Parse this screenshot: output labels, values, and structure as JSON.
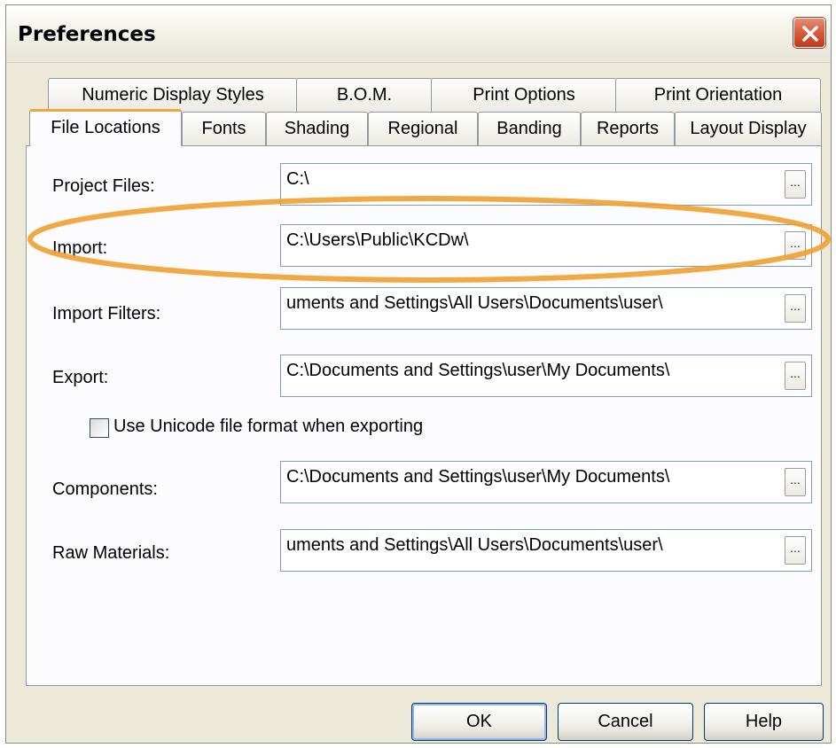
{
  "window": {
    "title": "Preferences",
    "close_icon": "close-icon"
  },
  "tabs": {
    "row1": [
      {
        "label": "Numeric Display Styles"
      },
      {
        "label": "B.O.M."
      },
      {
        "label": "Print Options"
      },
      {
        "label": "Print Orientation"
      }
    ],
    "row2": [
      {
        "label": "File Locations",
        "active": true
      },
      {
        "label": "Fonts"
      },
      {
        "label": "Shading"
      },
      {
        "label": "Regional"
      },
      {
        "label": "Banding"
      },
      {
        "label": "Reports"
      },
      {
        "label": "Layout Display"
      }
    ]
  },
  "fields": [
    {
      "label": "Project Files:",
      "value": "C:\\",
      "browse_label": "..."
    },
    {
      "label": "Import:",
      "value": "C:\\Users\\Public\\KCDw\\",
      "browse_label": "..."
    },
    {
      "label": "Import Filters:",
      "value": "uments and Settings\\All Users\\Documents\\user\\",
      "browse_label": "..."
    },
    {
      "label": "Export:",
      "value": "C:\\Documents and Settings\\user\\My Documents\\",
      "browse_label": "..."
    },
    {
      "label": "Components:",
      "value": "C:\\Documents and Settings\\user\\My Documents\\",
      "browse_label": "..."
    },
    {
      "label": "Raw Materials:",
      "value": "uments and Settings\\All Users\\Documents\\user\\",
      "browse_label": "..."
    }
  ],
  "unicode_checkbox": {
    "label": "Use Unicode file format when exporting",
    "checked": false
  },
  "buttons": {
    "ok": "OK",
    "cancel": "Cancel",
    "help": "Help"
  },
  "colors": {
    "dialog_bg": "#ece9d8",
    "active_tab_accent": "#f2a43c",
    "highlight_ring": "#f0a030",
    "close_button": "#d65a3a"
  }
}
